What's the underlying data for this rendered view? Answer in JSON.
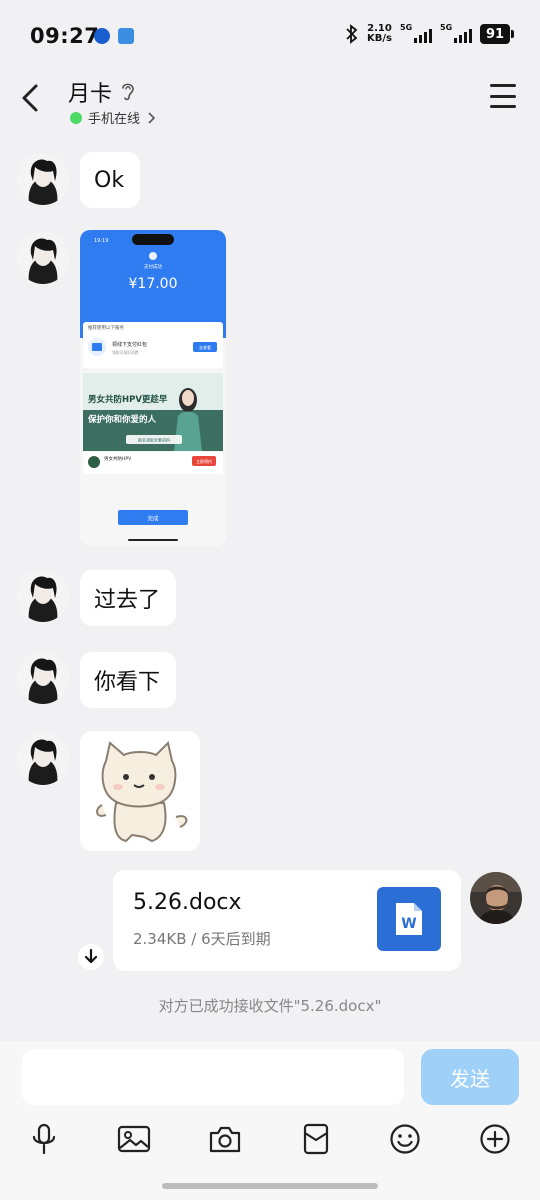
{
  "status_bar": {
    "time": "09:27",
    "net_speed_value": "2.10",
    "net_speed_unit": "KB/s",
    "signal1_label": "5G",
    "signal2_label": "5G",
    "battery": "91"
  },
  "header": {
    "contact_name": "月卡",
    "presence": "手机在线",
    "presence_color": "#4cd964"
  },
  "messages": [
    {
      "type": "text",
      "text": "Ok"
    },
    {
      "type": "image"
    },
    {
      "type": "text",
      "text": "过去了"
    },
    {
      "type": "text",
      "text": "你看下"
    },
    {
      "type": "sticker"
    }
  ],
  "screenshot_image": {
    "status_time": "19:19",
    "header": "支付成功",
    "amount": "¥17.00",
    "section_title": "推荐使用以下服务",
    "service_name": "领线下支付红包",
    "service_desc": "领取可抵扣消费",
    "service_button": "去查看",
    "banner_text_1": "男女共防HPV更趁早",
    "banner_text_2": "保护你和你爱的人",
    "banner_button": "报名领取全套资料",
    "promo_title": "男女共防HPV",
    "promo_button": "立即预约",
    "done_button": "完成"
  },
  "file_message": {
    "file_name": "5.26.docx",
    "meta": "2.34KB / 6天后到期",
    "icon": "word-doc-icon",
    "icon_letter": "W",
    "icon_color": "#2b6fd6"
  },
  "notice": "对方已成功接收文件\"5.26.docx\"",
  "composer": {
    "placeholder": "",
    "send_label": "发送",
    "send_color": "#9fd0f7"
  },
  "toolbar": [
    "microphone-icon",
    "image-icon",
    "camera-icon",
    "red-packet-icon",
    "emoji-icon",
    "plus-icon"
  ]
}
